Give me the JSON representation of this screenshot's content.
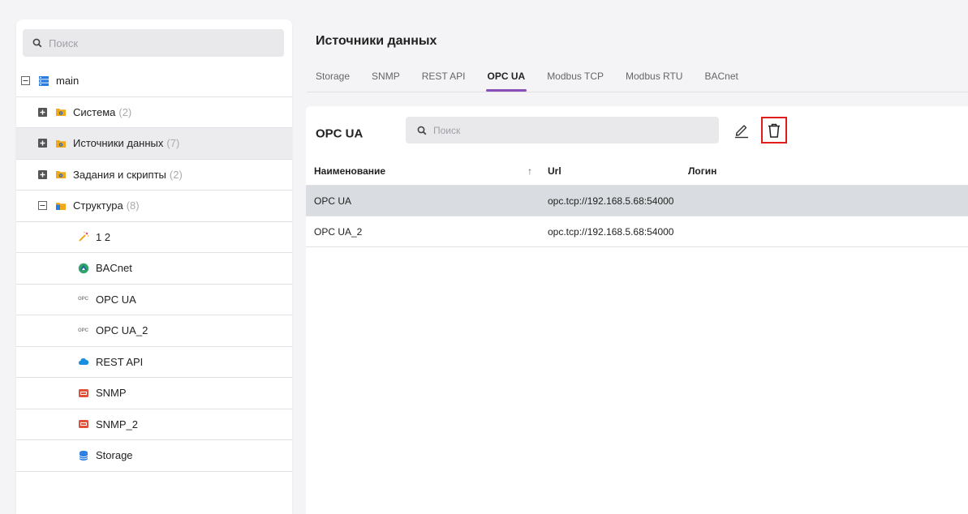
{
  "sidebar": {
    "search_placeholder": "Поиск",
    "root": {
      "label": "main"
    },
    "groups": [
      {
        "label": "Система",
        "count": "(2)"
      },
      {
        "label": "Источники данных",
        "count": "(7)"
      },
      {
        "label": "Задания и скрипты",
        "count": "(2)"
      },
      {
        "label": "Структура",
        "count": "(8)"
      }
    ],
    "children": [
      {
        "label": "1 2",
        "icon": "wand-icon"
      },
      {
        "label": "BACnet",
        "icon": "bacnet-icon"
      },
      {
        "label": "OPC UA",
        "icon": "opc-icon"
      },
      {
        "label": "OPC UA_2",
        "icon": "opc-icon"
      },
      {
        "label": "REST API",
        "icon": "cloud-icon"
      },
      {
        "label": "SNMP",
        "icon": "snmp-icon"
      },
      {
        "label": "SNMP_2",
        "icon": "snmp-icon"
      },
      {
        "label": "Storage",
        "icon": "database-icon"
      }
    ],
    "opc_text": "OPC"
  },
  "header": {
    "title": "Источники данных",
    "tabs": [
      "Storage",
      "SNMP",
      "REST API",
      "OPC UA",
      "Modbus TCP",
      "Modbus RTU",
      "BACnet"
    ],
    "active_tab": "OPC UA"
  },
  "card": {
    "title": "OPC UA",
    "search_placeholder": "Поиск",
    "columns": {
      "name": "Наименование",
      "sort": "↑",
      "url": "Url",
      "login": "Логин"
    },
    "rows": [
      {
        "name": "OPC UA",
        "url": "opc.tcp://192.168.5.68:54000",
        "login": ""
      },
      {
        "name": "OPC UA_2",
        "url": "opc.tcp://192.168.5.68:54000",
        "login": ""
      }
    ]
  },
  "colors": {
    "accent": "#8a4fb8",
    "delete_highlight": "#e01e1e",
    "folder": "#f0a81c"
  }
}
